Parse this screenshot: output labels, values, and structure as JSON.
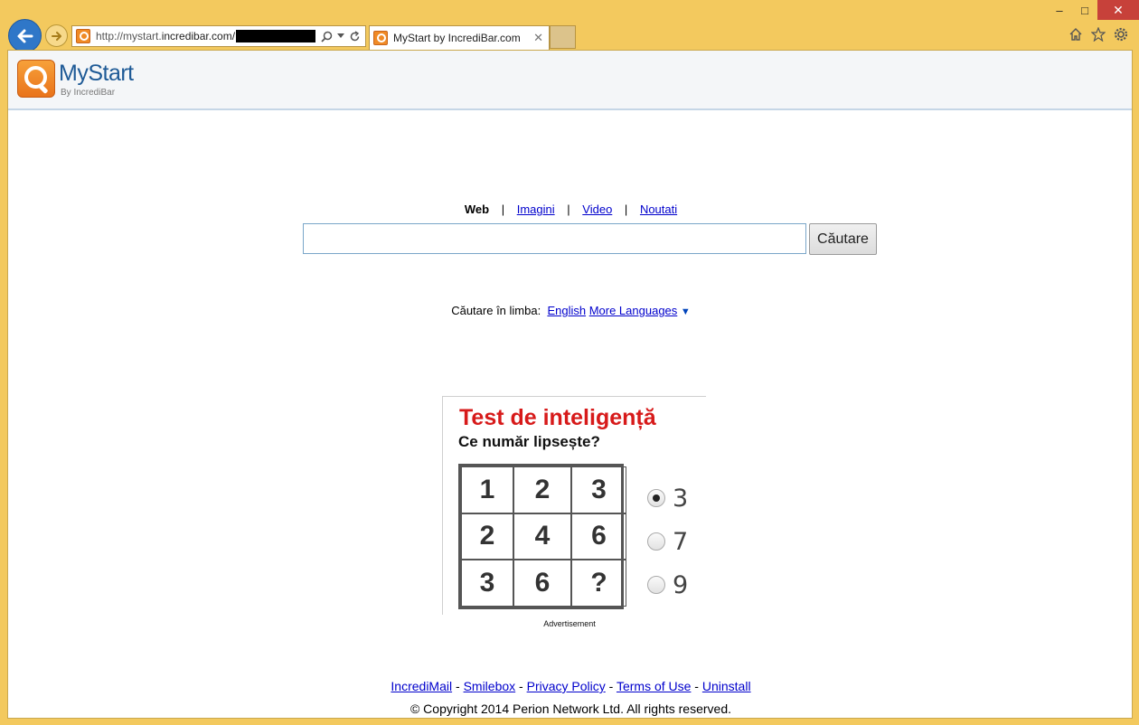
{
  "browser": {
    "address_prefix": "http://mystart.",
    "address_domain": "incredibar.com/",
    "tab_title": "MyStart by IncrediBar.com",
    "window_controls": {
      "minimize": "–",
      "maximize": "□",
      "close": "✕"
    }
  },
  "header": {
    "logo_text": "MyStart",
    "logo_sub": "By IncrediBar"
  },
  "search": {
    "tabs": [
      {
        "label": "Web",
        "active": true
      },
      {
        "label": "Imagini",
        "active": false
      },
      {
        "label": "Video",
        "active": false
      },
      {
        "label": "Noutati",
        "active": false
      }
    ],
    "input_value": "",
    "button_label": "Căutare",
    "language_prompt": "Căutare în limba:",
    "language_link": "English",
    "more_languages": "More Languages",
    "more_arrow": "▼"
  },
  "ad": {
    "title": "Test de inteligență",
    "question": "Ce număr lipsește?",
    "grid": [
      "1",
      "2",
      "3",
      "2",
      "4",
      "6",
      "3",
      "6",
      "?"
    ],
    "options": [
      {
        "label": "3",
        "checked": true
      },
      {
        "label": "7",
        "checked": false
      },
      {
        "label": "9",
        "checked": false
      }
    ],
    "caption": "Advertisement"
  },
  "footer": {
    "links": [
      "IncrediMail",
      "Smilebox",
      "Privacy Policy",
      "Terms of Use",
      "Uninstall"
    ],
    "separator": " - ",
    "copyright": "© Copyright 2014 Perion Network Ltd. All rights reserved."
  }
}
